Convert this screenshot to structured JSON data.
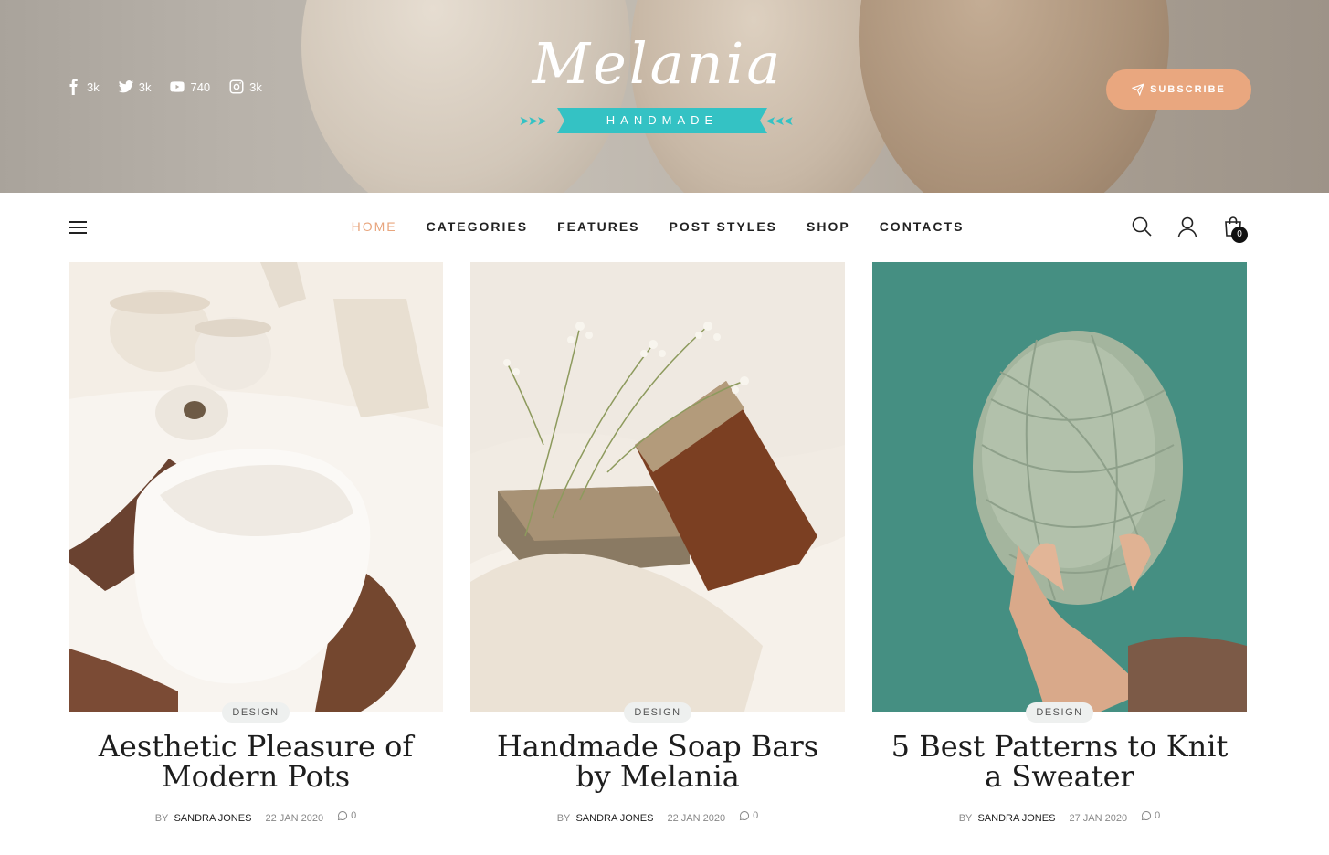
{
  "header": {
    "social": [
      {
        "icon": "facebook-icon",
        "count": "3k"
      },
      {
        "icon": "twitter-icon",
        "count": "3k"
      },
      {
        "icon": "youtube-icon",
        "count": "740"
      },
      {
        "icon": "instagram-icon",
        "count": "3k"
      }
    ],
    "logo": {
      "script": "Melania",
      "ribbon": "HANDMADE"
    },
    "subscribe_label": "SUBSCRIBE"
  },
  "nav": {
    "items": [
      {
        "label": "HOME",
        "active": true
      },
      {
        "label": "CATEGORIES",
        "active": false
      },
      {
        "label": "FEATURES",
        "active": false
      },
      {
        "label": "POST STYLES",
        "active": false
      },
      {
        "label": "SHOP",
        "active": false
      },
      {
        "label": "CONTACTS",
        "active": false
      }
    ],
    "cart_count": "0"
  },
  "posts": [
    {
      "category": "DESIGN",
      "title_line1": "Aesthetic Pleasure of",
      "title_line2": "Modern Pots",
      "by": "BY",
      "author": "SANDRA JONES",
      "date": "22 JAN 2020",
      "comments": "0"
    },
    {
      "category": "DESIGN",
      "title_line1": "Handmade Soap Bars",
      "title_line2": "by Melania",
      "by": "BY",
      "author": "SANDRA JONES",
      "date": "22 JAN 2020",
      "comments": "0"
    },
    {
      "category": "DESIGN",
      "title_line1": "5 Best Patterns to Knit",
      "title_line2": "a Sweater",
      "by": "BY",
      "author": "SANDRA JONES",
      "date": "27 JAN 2020",
      "comments": "0"
    }
  ],
  "colors": {
    "accent": "#e9a77f",
    "ribbon": "#34c2c4",
    "active_nav": "#e8a57d"
  }
}
